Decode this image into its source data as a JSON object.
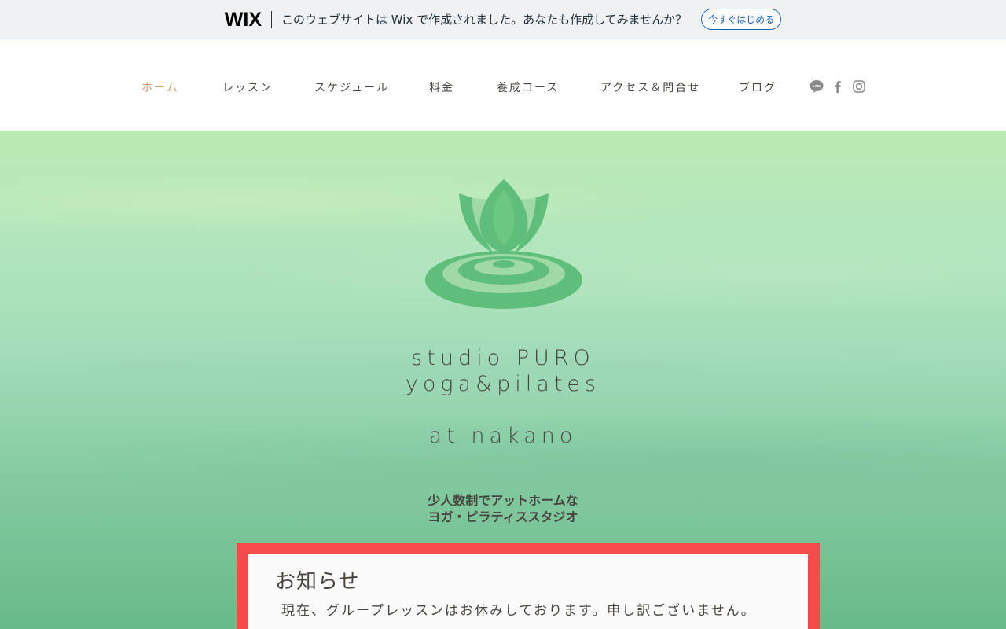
{
  "wix_banner": {
    "logo": "WIX",
    "message": "このウェブサイトは Wix で作成されました。あなたも作成してみませんか？",
    "cta": "今すぐはじめる"
  },
  "nav": {
    "items": [
      {
        "label": "ホーム",
        "active": true
      },
      {
        "label": "レッスン"
      },
      {
        "label": "スケジュール"
      },
      {
        "label": "料金"
      },
      {
        "label": "養成コース"
      },
      {
        "label": "アクセス＆問合せ"
      },
      {
        "label": "ブログ"
      }
    ],
    "social": [
      "line-icon",
      "facebook-icon",
      "instagram-icon"
    ],
    "social_line_label": "LINE"
  },
  "hero": {
    "brand_line1": "studio PURO",
    "brand_line2": "yoga&pilates",
    "brand_line3": "at nakano",
    "tagline_line1": "少人数制でアットホームな",
    "tagline_line2": "ヨガ・ピラティススタジオ"
  },
  "notice": {
    "title": "お知らせ",
    "body": "現在、グループレッスンはお休みしております。申し訳ございません。"
  },
  "colors": {
    "accent": "#c79a6c",
    "lotus": "#5fbf7a",
    "notice_border": "#f54b4b",
    "wix_blue": "#1665c0"
  }
}
